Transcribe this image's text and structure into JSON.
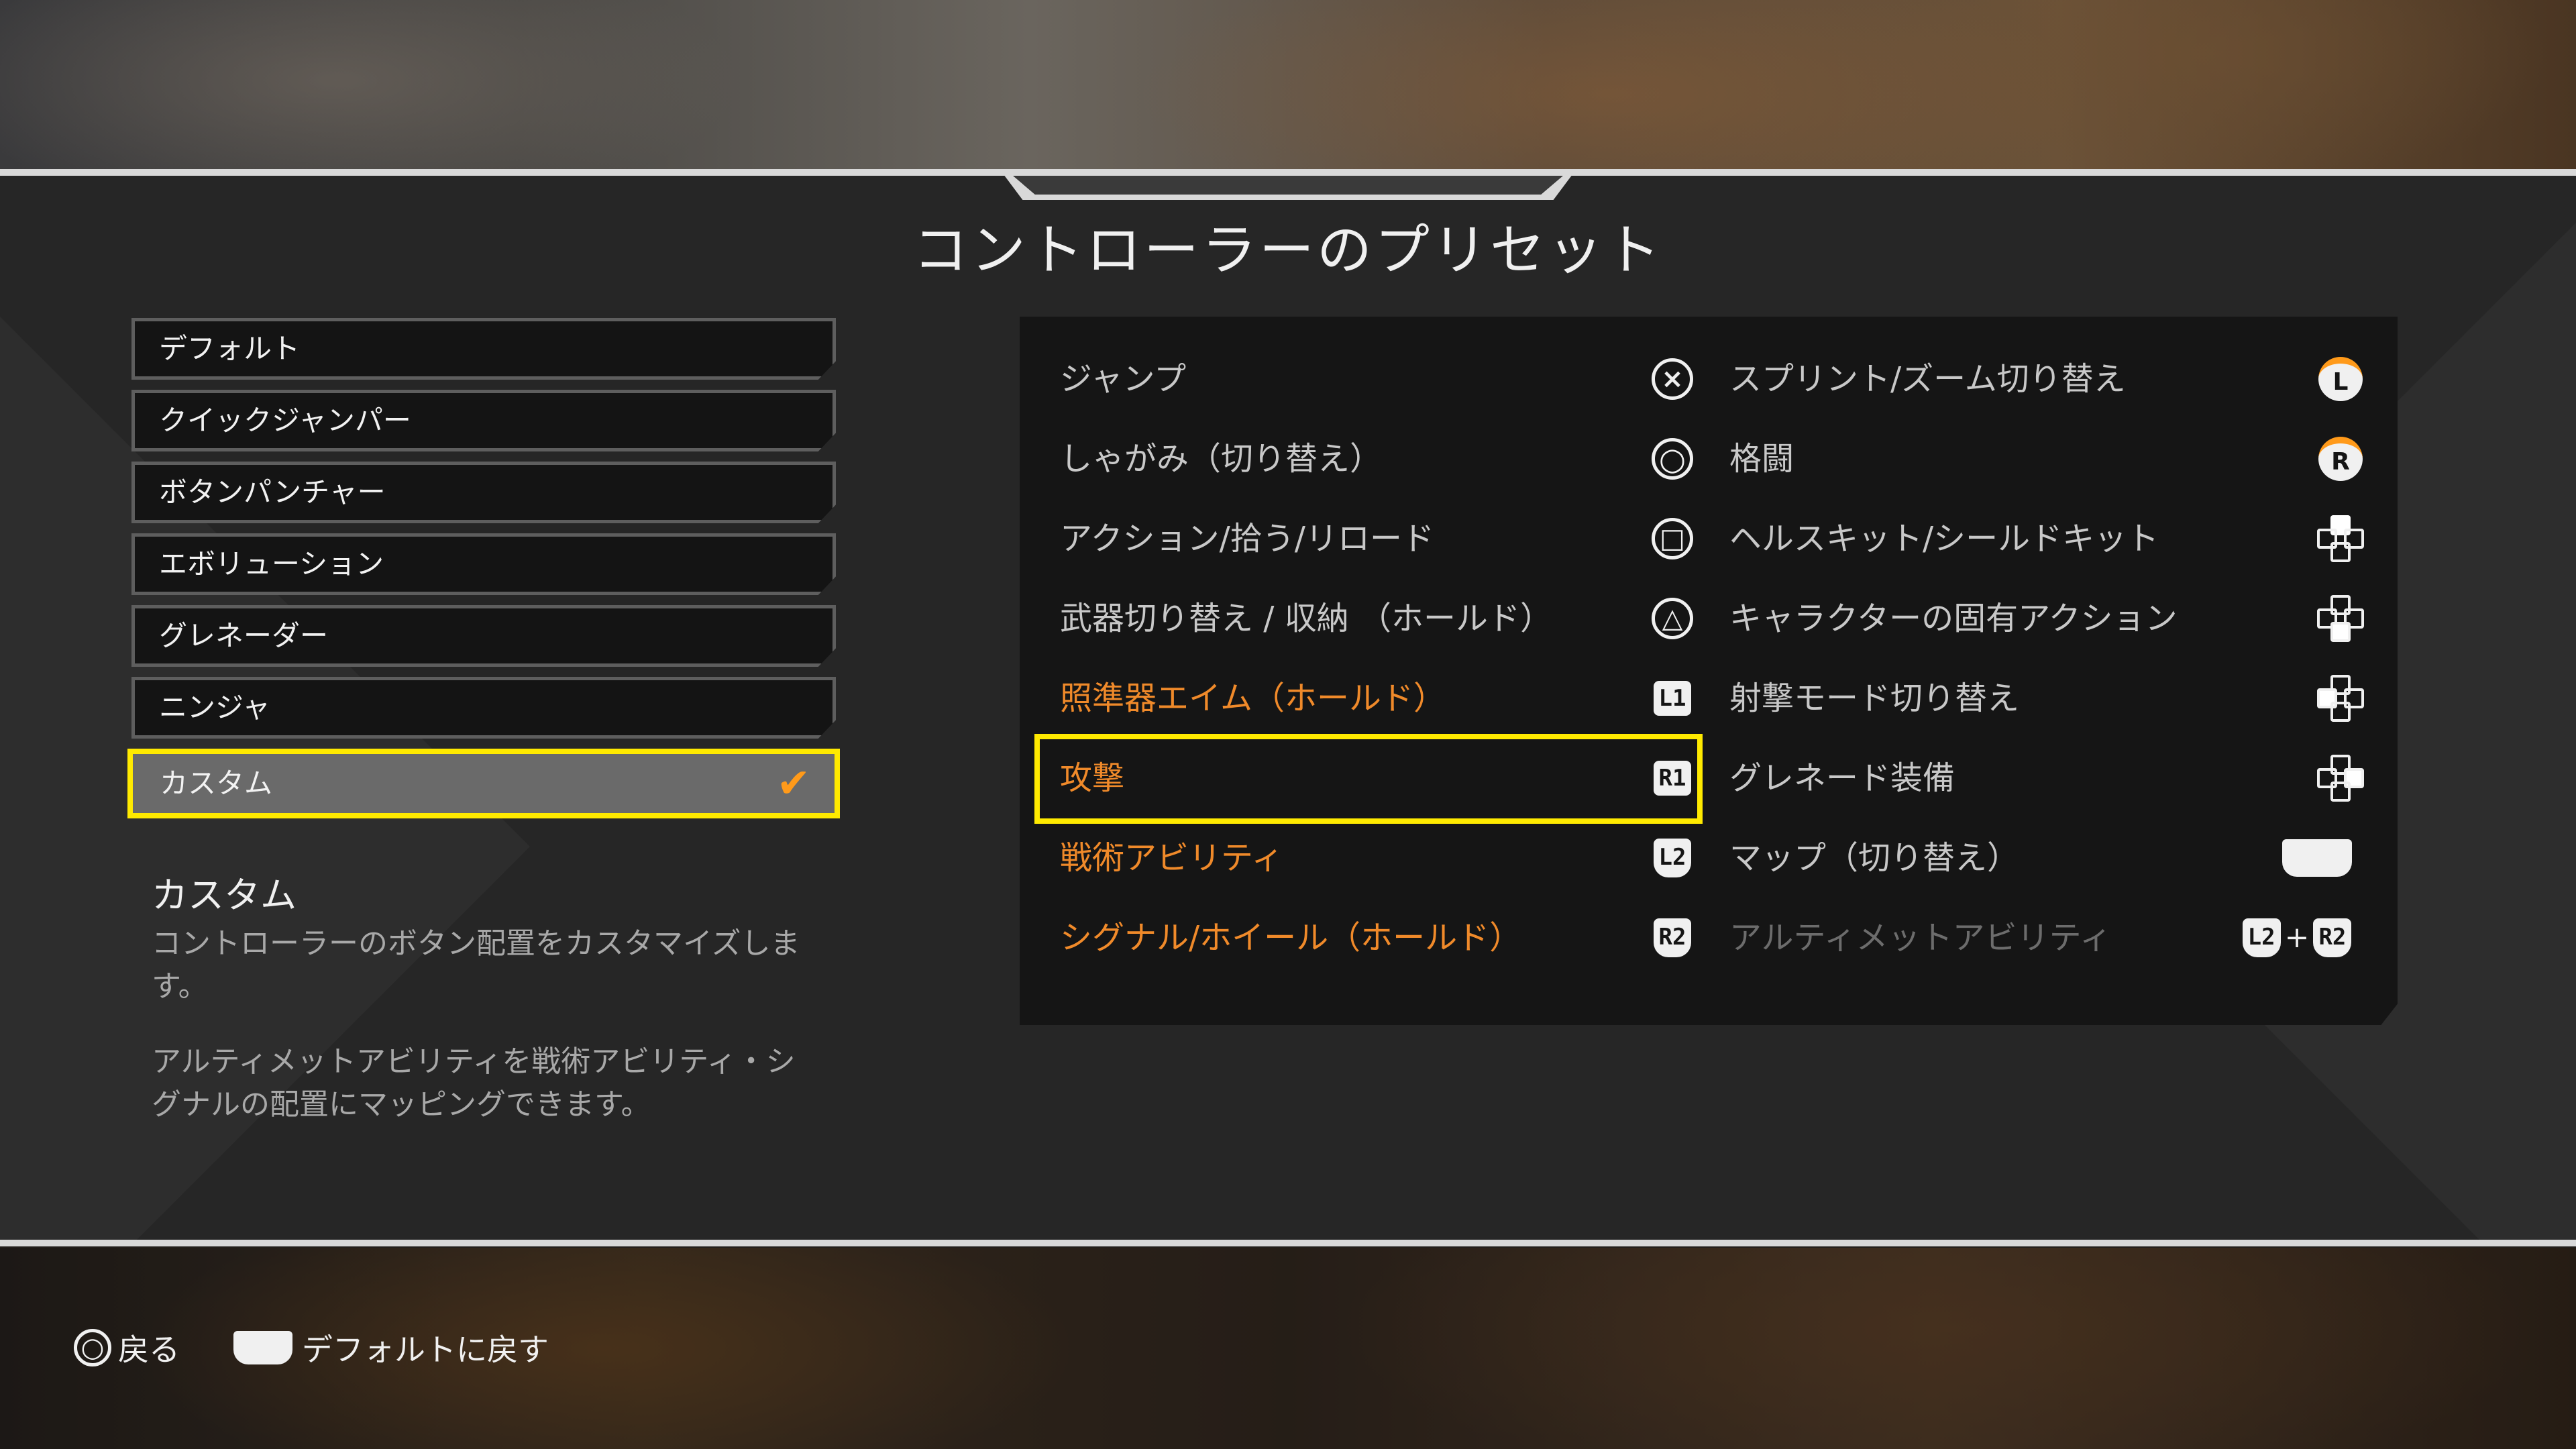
{
  "title": "コントローラーのプリセット",
  "presets": [
    {
      "label": "デフォルト"
    },
    {
      "label": "クイックジャンパー"
    },
    {
      "label": "ボタンパンチャー"
    },
    {
      "label": "エボリューション"
    },
    {
      "label": "グレネーダー"
    },
    {
      "label": "ニンジャ"
    },
    {
      "label": "カスタム",
      "selected": true
    }
  ],
  "selected_check": "✔",
  "description": {
    "title": "カスタム",
    "text1": "コントローラーのボタン配置をカスタマイズします。",
    "text2": "アルティメットアビリティを戦術アビリティ・シグナルの配置にマッピングできます。"
  },
  "bindings_left": [
    {
      "action": "ジャンプ",
      "button": "×",
      "glyph": "cross-button-icon",
      "color": "white"
    },
    {
      "action": "しゃがみ（切り替え）",
      "button": "○",
      "glyph": "circle-button-icon",
      "color": "white"
    },
    {
      "action": "アクション/拾う/リロード",
      "button": "□",
      "glyph": "square-button-icon",
      "color": "white"
    },
    {
      "action": "武器切り替え / 収納 （ホールド）",
      "button": "△",
      "glyph": "triangle-button-icon",
      "color": "white"
    },
    {
      "action": "照準器エイム（ホールド）",
      "button": "L1",
      "glyph": "l1-button-icon",
      "color": "orange"
    },
    {
      "action": "攻撃",
      "button": "R1",
      "glyph": "r1-button-icon",
      "color": "orange",
      "highlighted": true
    },
    {
      "action": "戦術アビリティ",
      "button": "L2",
      "glyph": "l2-trigger-icon",
      "color": "orange"
    },
    {
      "action": "シグナル/ホイール（ホールド）",
      "button": "R2",
      "glyph": "r2-trigger-icon",
      "color": "orange"
    }
  ],
  "bindings_right": [
    {
      "action": "スプリント/ズーム切り替え",
      "button": "L",
      "glyph": "left-stick-press-icon",
      "color": "white"
    },
    {
      "action": "格闘",
      "button": "R",
      "glyph": "right-stick-press-icon",
      "color": "white"
    },
    {
      "action": "ヘルスキット/シールドキット",
      "glyph": "dpad-icon",
      "color": "white"
    },
    {
      "action": "キャラクターの固有アクション",
      "glyph": "dpad-icon",
      "color": "white"
    },
    {
      "action": "射撃モード切り替え",
      "glyph": "dpad-icon",
      "color": "white"
    },
    {
      "action": "グレネード装備",
      "glyph": "dpad-icon",
      "color": "white"
    },
    {
      "action": "マップ（切り替え）",
      "glyph": "touchpad-icon",
      "color": "white"
    },
    {
      "action": "アルティメットアビリティ",
      "button": "L2",
      "button2": "R2",
      "combo_plus": "+",
      "glyph": "l2-r2-combo-icon",
      "color": "dim"
    }
  ],
  "footer": {
    "back_button_glyph": "○",
    "back_label": "戻る",
    "reset_label": "デフォルトに戻す"
  },
  "colors": {
    "highlight": "#ffea00",
    "orange": "#f08a2a",
    "check": "#ff9a1a"
  }
}
